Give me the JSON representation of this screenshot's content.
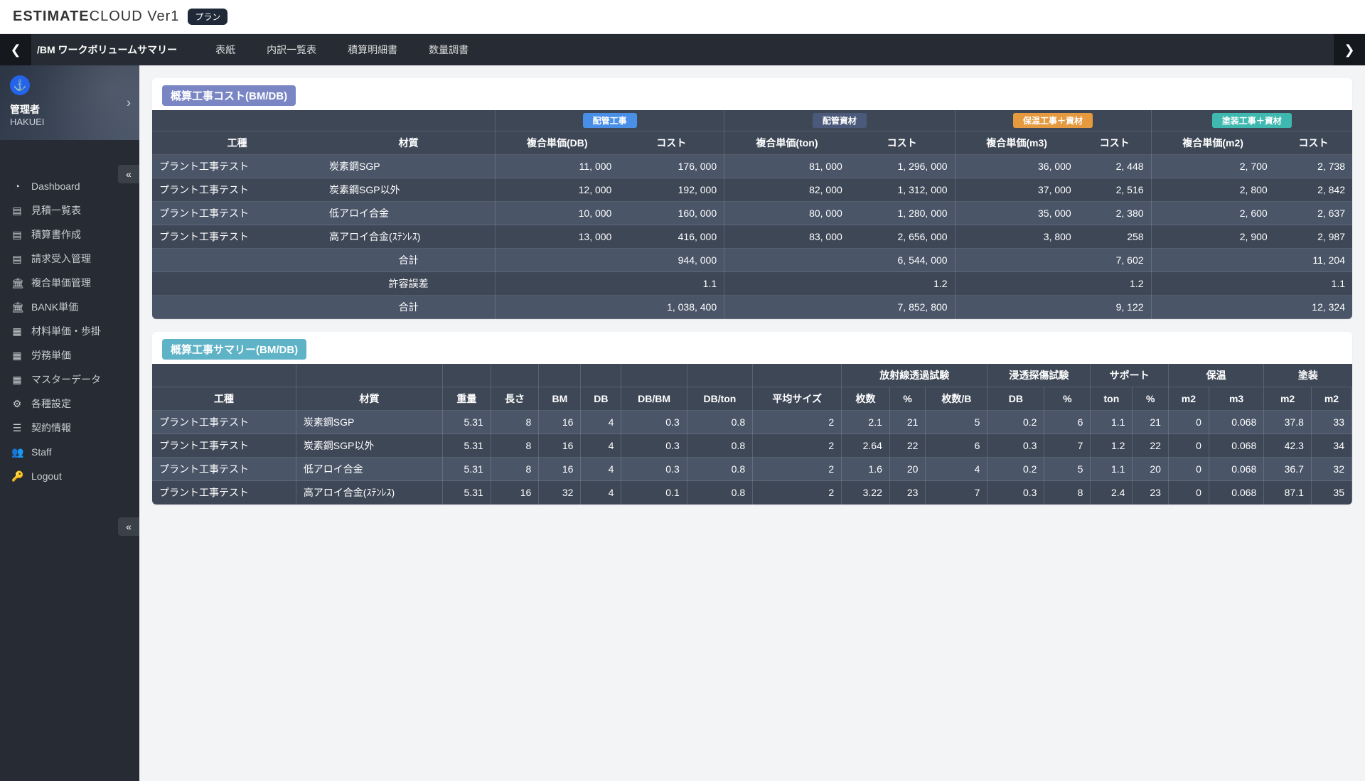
{
  "app": {
    "logo_bold": "ESTIMATE",
    "logo_light": "CLOUD Ver1",
    "plan_badge": "プラン"
  },
  "subbar": {
    "title": "/BM ワークボリュームサマリー",
    "tabs": [
      "表紙",
      "内訳一覧表",
      "積算明細書",
      "数量調書"
    ]
  },
  "user": {
    "role": "管理者",
    "name": "HAKUEI"
  },
  "nav": [
    {
      "icon": "◔",
      "label": "Dashboard"
    },
    {
      "icon": "▤",
      "label": "見積一覧表"
    },
    {
      "icon": "▤",
      "label": "積算書作成"
    },
    {
      "icon": "▤",
      "label": "請求受入管理"
    },
    {
      "icon": "🏛",
      "label": "複合単価管理"
    },
    {
      "icon": "🏛",
      "label": "BANK単価"
    },
    {
      "icon": "▦",
      "label": "材料単価・歩掛"
    },
    {
      "icon": "▦",
      "label": "労務単価"
    },
    {
      "icon": "▦",
      "label": "マスターデータ"
    },
    {
      "icon": "⚙",
      "label": "各種設定"
    },
    {
      "icon": "☰",
      "label": "契約情報"
    },
    {
      "icon": "👥",
      "label": "Staff"
    },
    {
      "icon": "🔑",
      "label": "Logout"
    }
  ],
  "section1": {
    "title": "概算工事コスト(BM/DB)",
    "groups": [
      "配管工事",
      "配管資材",
      "保温工事＋資材",
      "塗装工事＋資材"
    ],
    "headers": [
      "工種",
      "材質",
      "複合単価(DB)",
      "コスト",
      "複合単価(ton)",
      "コスト",
      "複合単価(m3)",
      "コスト",
      "複合単価(m2)",
      "コスト"
    ],
    "rows": [
      [
        "プラント工事テスト",
        "炭素鋼SGP",
        "11, 000",
        "176, 000",
        "81, 000",
        "1, 296, 000",
        "36, 000",
        "2, 448",
        "2, 700",
        "2, 738"
      ],
      [
        "プラント工事テスト",
        "炭素鋼SGP以外",
        "12, 000",
        "192, 000",
        "82, 000",
        "1, 312, 000",
        "37, 000",
        "2, 516",
        "2, 800",
        "2, 842"
      ],
      [
        "プラント工事テスト",
        "低アロイ合金",
        "10, 000",
        "160, 000",
        "80, 000",
        "1, 280, 000",
        "35, 000",
        "2, 380",
        "2, 600",
        "2, 637"
      ],
      [
        "プラント工事テスト",
        "高アロイ合金(ｽﾃﾝﾚｽ)",
        "13, 000",
        "416, 000",
        "83, 000",
        "2, 656, 000",
        "3, 800",
        "258",
        "2, 900",
        "2, 987"
      ]
    ],
    "totals": [
      [
        "",
        "合計",
        "",
        "944, 000",
        "",
        "6, 544, 000",
        "",
        "7, 602",
        "",
        "11, 204"
      ],
      [
        "",
        "許容誤差",
        "",
        "1.1",
        "",
        "1.2",
        "",
        "1.2",
        "",
        "1.1"
      ],
      [
        "",
        "合計",
        "",
        "1, 038, 400",
        "",
        "7, 852, 800",
        "",
        "9, 122",
        "",
        "12, 324"
      ]
    ]
  },
  "section2": {
    "title": "概算工事サマリー(BM/DB)",
    "topGroups": [
      "",
      "",
      "",
      "",
      "",
      "",
      "",
      "",
      "放射線透過試験",
      "浸透探傷試験",
      "サポート",
      "保温",
      "塗装"
    ],
    "headers": [
      "工種",
      "材質",
      "重量",
      "長さ",
      "BM",
      "DB",
      "DB/BM",
      "DB/ton",
      "平均サイズ",
      "枚数",
      "%",
      "枚数/B",
      "DB",
      "%",
      "ton",
      "%",
      "m2",
      "m3",
      "m2",
      "m2"
    ],
    "rows": [
      [
        "プラント工事テスト",
        "炭素鋼SGP",
        "5.31",
        "8",
        "16",
        "4",
        "0.3",
        "0.8",
        "2",
        "2.1",
        "21",
        "5",
        "0.2",
        "6",
        "1.1",
        "21",
        "0",
        "0.068",
        "37.8",
        "33"
      ],
      [
        "プラント工事テスト",
        "炭素鋼SGP以外",
        "5.31",
        "8",
        "16",
        "4",
        "0.3",
        "0.8",
        "2",
        "2.64",
        "22",
        "6",
        "0.3",
        "7",
        "1.2",
        "22",
        "0",
        "0.068",
        "42.3",
        "34"
      ],
      [
        "プラント工事テスト",
        "低アロイ合金",
        "5.31",
        "8",
        "16",
        "4",
        "0.3",
        "0.8",
        "2",
        "1.6",
        "20",
        "4",
        "0.2",
        "5",
        "1.1",
        "20",
        "0",
        "0.068",
        "36.7",
        "32"
      ],
      [
        "プラント工事テスト",
        "高アロイ合金(ｽﾃﾝﾚｽ)",
        "5.31",
        "16",
        "32",
        "4",
        "0.1",
        "0.8",
        "2",
        "3.22",
        "23",
        "7",
        "0.3",
        "8",
        "2.4",
        "23",
        "0",
        "0.068",
        "87.1",
        "35"
      ]
    ]
  }
}
